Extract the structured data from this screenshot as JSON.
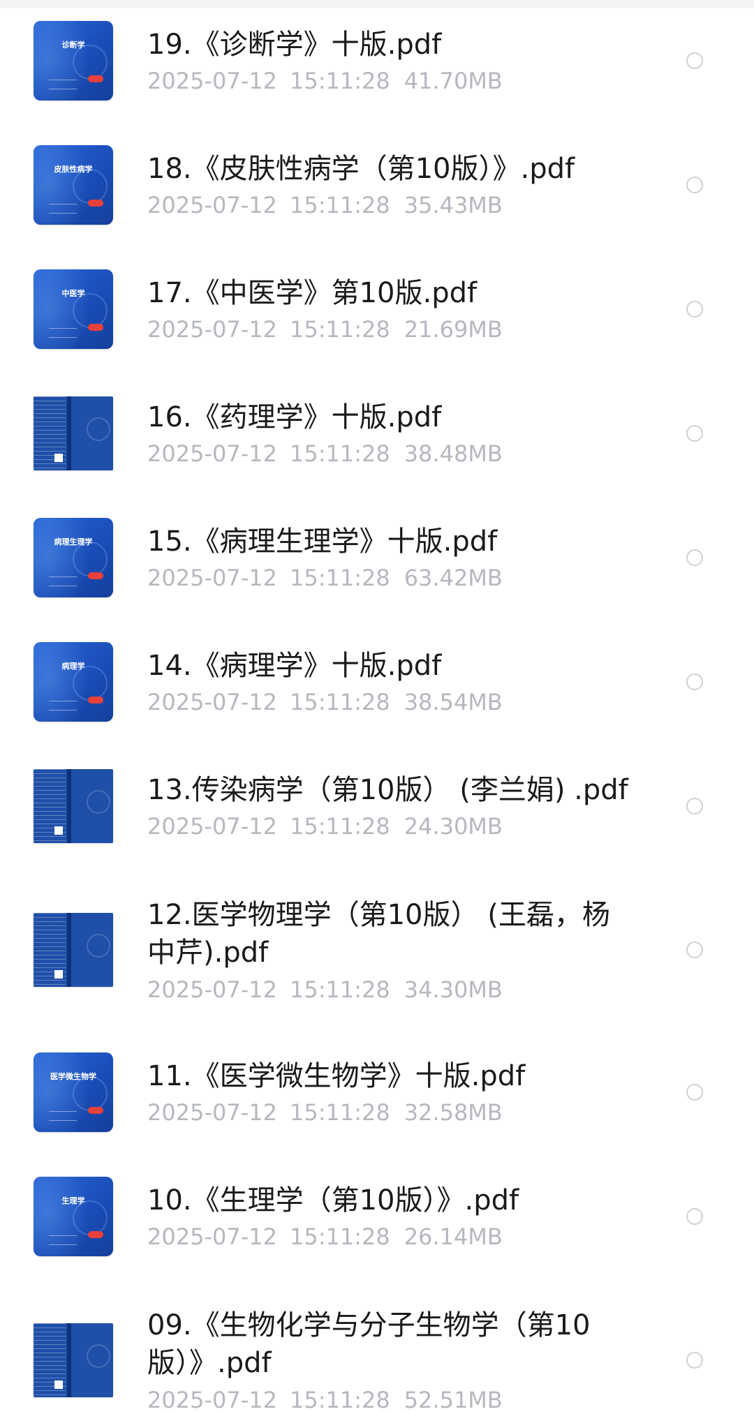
{
  "files": [
    {
      "name": "19.《诊断学》十版.pdf",
      "date": "2025-07-12",
      "time": "15:11:28",
      "size": "41.70MB",
      "cover": "诊断学"
    },
    {
      "name": "18.《皮肤性病学（第10版）》.pdf",
      "date": "2025-07-12",
      "time": "15:11:28",
      "size": "35.43MB",
      "cover": "皮肤性病学"
    },
    {
      "name": "17.《中医学》第10版.pdf",
      "date": "2025-07-12",
      "time": "15:11:28",
      "size": "21.69MB",
      "cover": "中医学"
    },
    {
      "name": "16.《药理学》十版.pdf",
      "date": "2025-07-12",
      "time": "15:11:28",
      "size": "38.48MB",
      "cover": ""
    },
    {
      "name": "15.《病理生理学》十版.pdf",
      "date": "2025-07-12",
      "time": "15:11:28",
      "size": "63.42MB",
      "cover": "病理生理学"
    },
    {
      "name": "14.《病理学》十版.pdf",
      "date": "2025-07-12",
      "time": "15:11:28",
      "size": "38.54MB",
      "cover": "病理学"
    },
    {
      "name": "13.传染病学（第10版） (李兰娟) .pdf",
      "date": "2025-07-12",
      "time": "15:11:28",
      "size": "24.30MB",
      "cover": ""
    },
    {
      "name": "12.医学物理学（第10版） (王磊，杨中芹).pdf",
      "date": "2025-07-12",
      "time": "15:11:28",
      "size": "34.30MB",
      "cover": ""
    },
    {
      "name": "11.《医学微生物学》十版.pdf",
      "date": "2025-07-12",
      "time": "15:11:28",
      "size": "32.58MB",
      "cover": "医学微生物学"
    },
    {
      "name": "10.《生理学（第10版）》.pdf",
      "date": "2025-07-12",
      "time": "15:11:28",
      "size": "26.14MB",
      "cover": "生理学"
    },
    {
      "name": "09.《生物化学与分子生物学（第10版）》.pdf",
      "date": "2025-07-12",
      "time": "15:11:28",
      "size": "52.51MB",
      "cover": ""
    }
  ]
}
